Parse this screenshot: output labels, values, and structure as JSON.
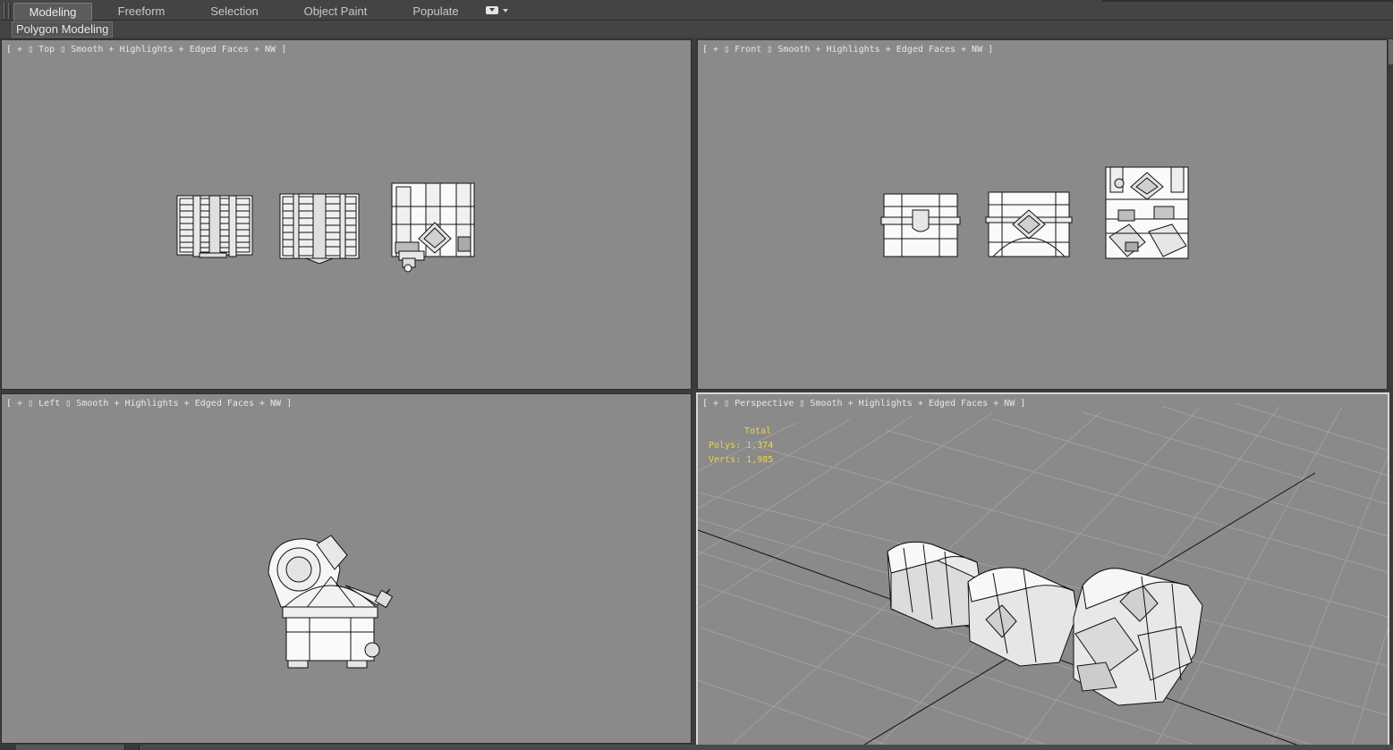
{
  "ribbon": {
    "tabs": [
      {
        "label": "Modeling",
        "active": true
      },
      {
        "label": "Freeform",
        "active": false
      },
      {
        "label": "Selection",
        "active": false
      },
      {
        "label": "Object Paint",
        "active": false
      },
      {
        "label": "Populate",
        "active": false
      }
    ],
    "more_icon": "dropdown-toggle-icon",
    "panel_label": "Polygon Modeling"
  },
  "viewports": {
    "top": {
      "label_open": "[ + ",
      "label_view": "Top",
      "label_mode": "Smooth + Highlights + Edged Faces + NW ]"
    },
    "front": {
      "label_open": "[ + ",
      "label_view": "Front",
      "label_mode": "Smooth + Highlights + Edged Faces + NW ]"
    },
    "left": {
      "label_open": "[ + ",
      "label_view": "Left",
      "label_mode": "Smooth + Highlights + Edged Faces + NW ]"
    },
    "perspective": {
      "label_open": "[ + ",
      "label_view": "Perspective",
      "label_mode": "Smooth + Highlights + Edged Faces + NW ]",
      "active": true,
      "stats": {
        "heading": "Total",
        "polys_label": "Polys:",
        "polys_value": "1,374",
        "verts_label": "Verts:",
        "verts_value": "1,985"
      }
    }
  },
  "colors": {
    "viewport_bg": "#8a8a8a",
    "stats_text": "#f2d33a",
    "label_text": "#e8e8e8",
    "active_border": "#d8d8d8"
  }
}
